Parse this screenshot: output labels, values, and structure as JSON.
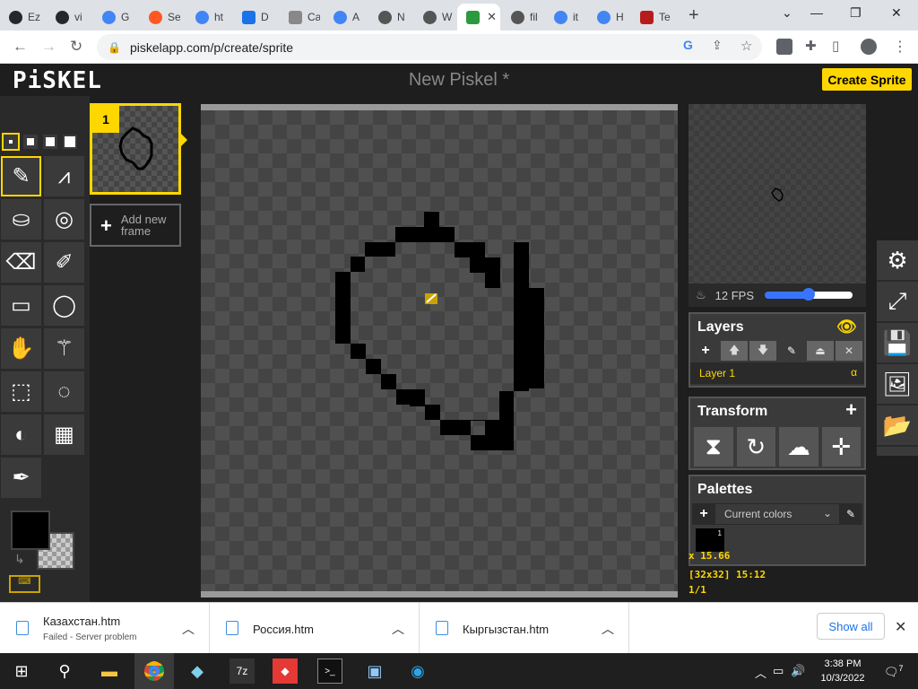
{
  "browser": {
    "tabs": [
      {
        "label": "Ez",
        "favicon": "github-icon",
        "color": "#24292e"
      },
      {
        "label": "vi",
        "favicon": "github-icon",
        "color": "#24292e"
      },
      {
        "label": "G",
        "favicon": "google-icon",
        "color": "#4285f4"
      },
      {
        "label": "Se",
        "favicon": "swirl-icon",
        "color": "#ff5722"
      },
      {
        "label": "ht",
        "favicon": "google-icon",
        "color": "#4285f4"
      },
      {
        "label": "D",
        "favicon": "download-icon",
        "color": "#1a73e8"
      },
      {
        "label": "Ca",
        "favicon": "image-icon",
        "color": "#888888"
      },
      {
        "label": "A",
        "favicon": "google-icon",
        "color": "#4285f4"
      },
      {
        "label": "N",
        "favicon": "globe-icon",
        "color": "#555555"
      },
      {
        "label": "W",
        "favicon": "globe-icon",
        "color": "#555555"
      },
      {
        "label": "",
        "favicon": "piskel-icon",
        "color": "#2b9a3e",
        "active": true
      },
      {
        "label": "fil",
        "favicon": "globe-icon",
        "color": "#555555"
      },
      {
        "label": "it",
        "favicon": "google-icon",
        "color": "#4285f4"
      },
      {
        "label": "H",
        "favicon": "google-icon",
        "color": "#4285f4"
      },
      {
        "label": "Te",
        "favicon": "flag-icon",
        "color": "#b71c1c"
      }
    ],
    "url": "piskelapp.com/p/create/sprite"
  },
  "app": {
    "logo": "PiSKEL",
    "title": "New Piskel *",
    "create_button": "Create Sprite",
    "frames": {
      "current_index": "1",
      "add_label_line1": "Add new",
      "add_label_line2": "frame"
    },
    "preview": {
      "fps_label": "12 FPS",
      "fps_value": 12
    },
    "layers": {
      "title": "Layers",
      "layer_name": "Layer 1",
      "alpha_symbol": "α"
    },
    "transform": {
      "title": "Transform"
    },
    "palettes": {
      "title": "Palettes",
      "selected": "Current colors",
      "swatch_index": "1",
      "swatch_color": "#000000"
    },
    "status": {
      "cursor": "x 15.66",
      "size_time": "[32x32] 15:12",
      "frame_count": "1/1"
    },
    "colors": {
      "primary": "#000000",
      "accent": "#ffd700"
    }
  },
  "downloads": {
    "items": [
      {
        "name": "Казахстан.htm",
        "status": "Failed - Server problem"
      },
      {
        "name": "Россия.htm",
        "status": ""
      },
      {
        "name": "Кыргызстан.htm",
        "status": ""
      }
    ],
    "show_all": "Show all"
  },
  "taskbar": {
    "time": "3:38 PM",
    "date": "10/3/2022",
    "notifications": "7"
  }
}
